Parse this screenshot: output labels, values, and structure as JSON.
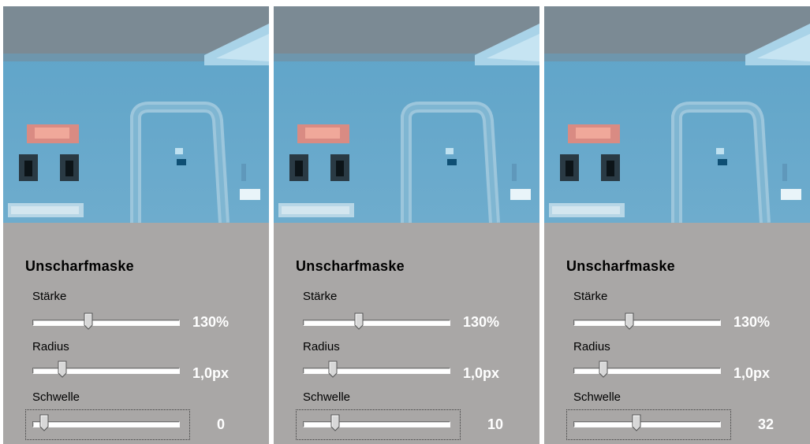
{
  "panels": [
    {
      "title": "Unscharfmaske",
      "staerke_label": "Stärke",
      "staerke_value": "130%",
      "staerke_level": 0.37,
      "radius_label": "Radius",
      "radius_value": "1,0px",
      "radius_level": 0.18,
      "schwelle_label": "Schwelle",
      "schwelle_value": "0",
      "schwelle_level": 0.05
    },
    {
      "title": "Unscharfmaske",
      "staerke_label": "Stärke",
      "staerke_value": "130%",
      "staerke_level": 0.37,
      "radius_label": "Radius",
      "radius_value": "1,0px",
      "radius_level": 0.18,
      "schwelle_label": "Schwelle",
      "schwelle_value": "10",
      "schwelle_level": 0.2
    },
    {
      "title": "Unscharfmaske",
      "staerke_label": "Stärke",
      "staerke_value": "130%",
      "staerke_level": 0.37,
      "radius_label": "Radius",
      "radius_value": "1,0px",
      "radius_level": 0.18,
      "schwelle_label": "Schwelle",
      "schwelle_value": "32",
      "schwelle_level": 0.42
    }
  ],
  "colors": {
    "panel_bg": "#a9a7a6",
    "preview_sky": "#5a9ec2",
    "preview_top": "#7d8a92"
  }
}
